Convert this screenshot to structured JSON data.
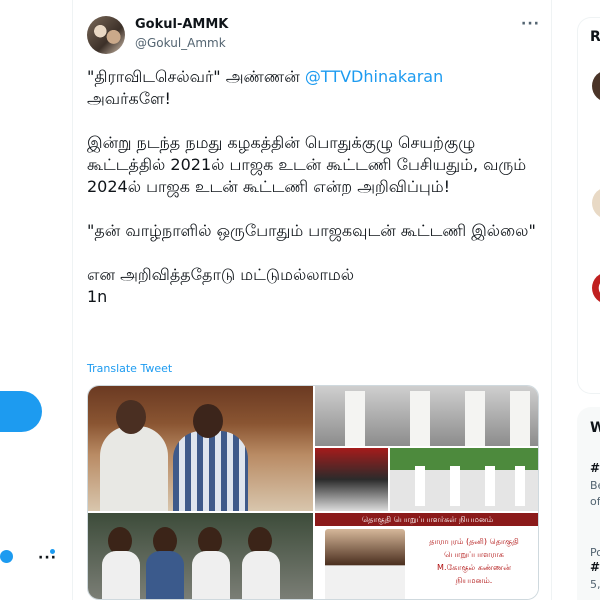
{
  "tweet": {
    "author_name": "Gokul-AMMK",
    "author_handle": "@Gokul_Ammk",
    "more_label": "···",
    "line1_pre": "\"திராவிடசெல்வர்\" அண்ணன் ",
    "mention": "@TTVDhinakaran",
    "line2": "அவர்களே!",
    "para2": "இன்று நடந்த நமது கழகத்தின் பொதுக்குழு செயற்குழு கூட்டத்தில் 2021ல் பாஜக உடன் கூட்டணி பேசியதும், வரும் 2024ல் பாஜக உடன் கூட்டணி என்ற அறிவிப்பும்!",
    "para3": "\"தன் வாழ்நாளில் ஒருபோதும் பாஜகவுடன் கூட்டணி இல்லை\"",
    "para4": "என அறிவித்ததோடு மட்டுமல்லாமல்",
    "para5": "1n",
    "translate_label": "Translate Tweet",
    "media": {
      "banner_text": "தொகுதி பொறுப்பாளர்கள் நியமனம்",
      "caption_line1": "தாராபுரம் (தனி) தொகுதி",
      "caption_line2": "பொறுப்பாளராக",
      "caption_line3": "M.கோகுல் கண்ணன்",
      "caption_line4": "நியமனம்."
    }
  },
  "left_nav": {
    "more_label": "···"
  },
  "right_sidebar": {
    "section1_label": "R",
    "section2_label": "W",
    "trend_lines": [
      {
        "text": "#",
        "style": "bold"
      },
      {
        "text": "Be",
        "style": "gray"
      },
      {
        "text": "of",
        "style": "gray"
      },
      {
        "text": "Po",
        "style": "gray"
      },
      {
        "text": "#I",
        "style": "bold"
      },
      {
        "text": "5,",
        "style": "gray"
      }
    ]
  },
  "colors": {
    "accent": "#1d9bf0",
    "text": "#0f1419",
    "secondary_text": "#536471"
  }
}
